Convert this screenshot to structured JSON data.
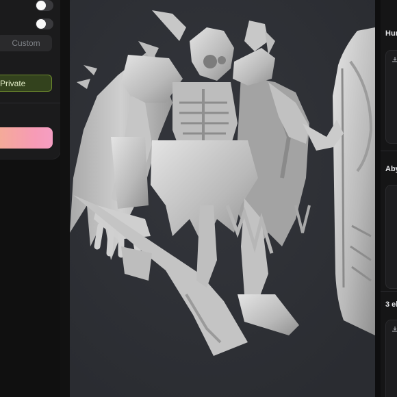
{
  "settings_panel": {
    "toggle_1_on": false,
    "toggle_2_on": false,
    "custom_field_value": "Custom",
    "visibility_button_label": "Private",
    "accent_color": "#6c8a2d",
    "gradient_colors": [
      "#f4ad93",
      "#f59ec3"
    ]
  },
  "viewport": {
    "background_color": "#2d2f34",
    "model_color": "#c9c9c9",
    "icon": "armored-skeleton-knight-model"
  },
  "model_list": {
    "sections": [
      {
        "title": "Hun"
      },
      {
        "title": "Aby"
      },
      {
        "title": "3 el"
      }
    ],
    "card_icon": "download-icon"
  }
}
